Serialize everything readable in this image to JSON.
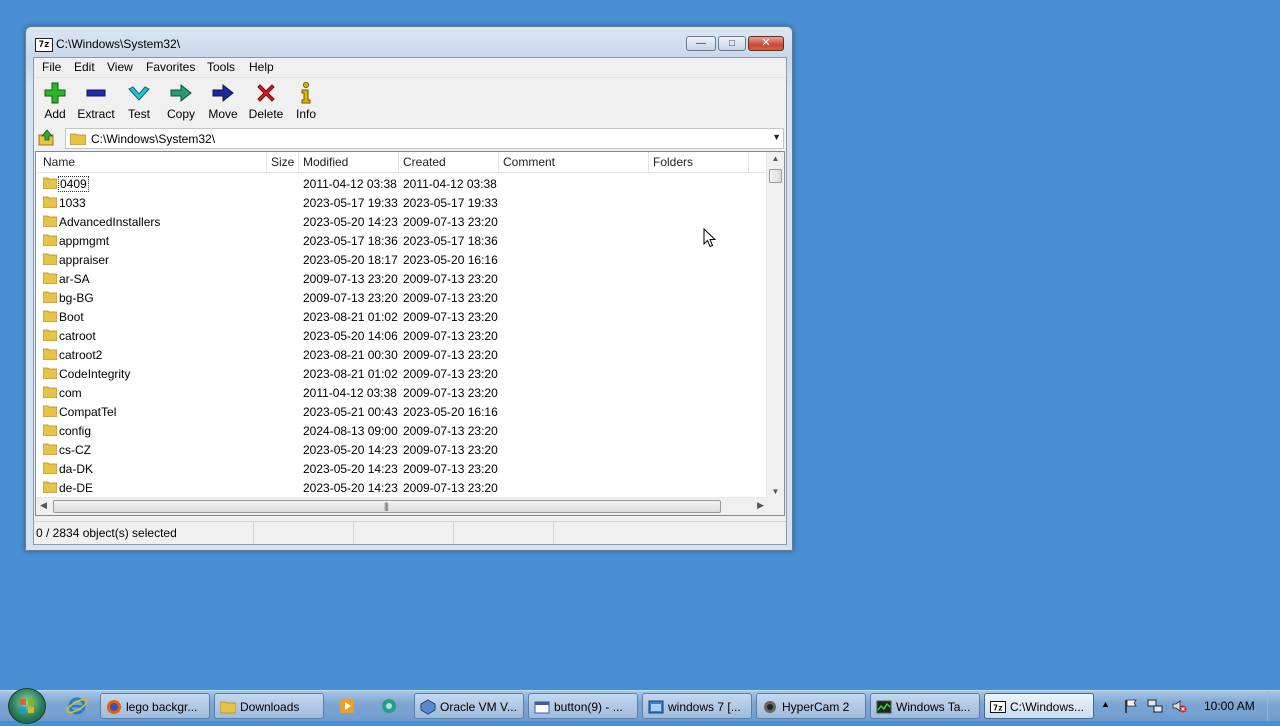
{
  "window": {
    "title": "C:\\Windows\\System32\\",
    "app_icon_label": "7z",
    "controls": {
      "minimize": "—",
      "maximize": "□",
      "close": "✕"
    }
  },
  "menu": {
    "items": [
      "File",
      "Edit",
      "View",
      "Favorites",
      "Tools",
      "Help"
    ]
  },
  "toolbar": {
    "buttons": [
      {
        "label": "Add",
        "icon": "add-plus-icon",
        "color": "#22aa22"
      },
      {
        "label": "Extract",
        "icon": "extract-minus-icon",
        "color": "#1c2fa8"
      },
      {
        "label": "Test",
        "icon": "test-check-icon",
        "color": "#1aa3b8"
      },
      {
        "label": "Copy",
        "icon": "copy-arrow-icon",
        "color": "#2b8f6a"
      },
      {
        "label": "Move",
        "icon": "move-arrow-icon",
        "color": "#1a2a8c"
      },
      {
        "label": "Delete",
        "icon": "delete-x-icon",
        "color": "#d42020"
      },
      {
        "label": "Info",
        "icon": "info-icon",
        "color": "#c8a400"
      }
    ]
  },
  "address": {
    "path": "C:\\Windows\\System32\\"
  },
  "list": {
    "columns": [
      "Name",
      "Size",
      "Modified",
      "Created",
      "Comment",
      "Folders"
    ],
    "rows": [
      {
        "name": "0409",
        "modified": "2011-04-12 03:38",
        "created": "2011-04-12 03:38"
      },
      {
        "name": "1033",
        "modified": "2023-05-17 19:33",
        "created": "2023-05-17 19:33"
      },
      {
        "name": "AdvancedInstallers",
        "modified": "2023-05-20 14:23",
        "created": "2009-07-13 23:20"
      },
      {
        "name": "appmgmt",
        "modified": "2023-05-17 18:36",
        "created": "2023-05-17 18:36"
      },
      {
        "name": "appraiser",
        "modified": "2023-05-20 18:17",
        "created": "2023-05-20 16:16"
      },
      {
        "name": "ar-SA",
        "modified": "2009-07-13 23:20",
        "created": "2009-07-13 23:20"
      },
      {
        "name": "bg-BG",
        "modified": "2009-07-13 23:20",
        "created": "2009-07-13 23:20"
      },
      {
        "name": "Boot",
        "modified": "2023-08-21 01:02",
        "created": "2009-07-13 23:20"
      },
      {
        "name": "catroot",
        "modified": "2023-05-20 14:06",
        "created": "2009-07-13 23:20"
      },
      {
        "name": "catroot2",
        "modified": "2023-08-21 00:30",
        "created": "2009-07-13 23:20"
      },
      {
        "name": "CodeIntegrity",
        "modified": "2023-08-21 01:02",
        "created": "2009-07-13 23:20"
      },
      {
        "name": "com",
        "modified": "2011-04-12 03:38",
        "created": "2009-07-13 23:20"
      },
      {
        "name": "CompatTel",
        "modified": "2023-05-21 00:43",
        "created": "2023-05-20 16:16"
      },
      {
        "name": "config",
        "modified": "2024-08-13 09:00",
        "created": "2009-07-13 23:20"
      },
      {
        "name": "cs-CZ",
        "modified": "2023-05-20 14:23",
        "created": "2009-07-13 23:20"
      },
      {
        "name": "da-DK",
        "modified": "2023-05-20 14:23",
        "created": "2009-07-13 23:20"
      },
      {
        "name": "de-DE",
        "modified": "2023-05-20 14:23",
        "created": "2009-07-13 23:20"
      }
    ]
  },
  "status": {
    "selection": "0 / 2834 object(s) selected"
  },
  "taskbar": {
    "tasks": [
      {
        "label": "lego backgr...",
        "icon": "firefox-icon"
      },
      {
        "label": "Downloads",
        "icon": "folder-icon"
      },
      {
        "label": "Oracle VM V...",
        "icon": "virtualbox-icon"
      },
      {
        "label": "button(9) - ...",
        "icon": "window-icon"
      },
      {
        "label": "windows 7 [...",
        "icon": "vm-window-icon"
      },
      {
        "label": "HyperCam 2",
        "icon": "hypercam-icon"
      },
      {
        "label": "Windows Ta...",
        "icon": "task-manager-icon"
      },
      {
        "label": "C:\\Windows...",
        "icon": "7zip-icon"
      }
    ],
    "clock": "10:00 AM"
  },
  "colors": {
    "desktop": "#4a8fd4",
    "folder": "#e8c34a"
  }
}
